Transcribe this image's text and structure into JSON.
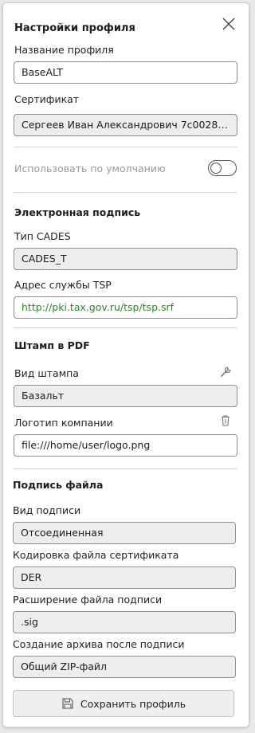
{
  "header": {
    "title": "Настройки профиля",
    "close_icon": "close-icon"
  },
  "profile": {
    "name_label": "Название профиля",
    "name_value": "BaseALT",
    "cert_label": "Сертификат",
    "cert_value": "Сергеев Иван Александрович 7c002876b7...",
    "default_label": "Использовать по умолчанию",
    "default_enabled": false
  },
  "signature": {
    "heading": "Электронная подпись",
    "type_label": "Тип CADES",
    "type_value": "CADES_T",
    "tsp_label": "Адрес службы TSP",
    "tsp_value": "http://pki.tax.gov.ru/tsp/tsp.srf"
  },
  "stamp": {
    "heading": "Штамп в PDF",
    "kind_label": "Вид штампа",
    "kind_value": "Базальт",
    "kind_icon": "wrench-icon",
    "logo_label": "Логотип компании",
    "logo_value": "file:///home/user/logo.png",
    "logo_icon": "trash-icon"
  },
  "file_sign": {
    "heading": "Подпись файла",
    "kind_label": "Вид подписи",
    "kind_value": "Отсоединенная",
    "encoding_label": "Кодировка файла сертификата",
    "encoding_value": "DER",
    "ext_label": "Расширение файла подписи",
    "ext_value": ".sig",
    "archive_label": "Создание архива после подписи",
    "archive_value": "Общий ZIP-файл"
  },
  "actions": {
    "save_label": "Сохранить профиль",
    "save_icon": "floppy-disk-icon"
  },
  "colors": {
    "link": "#2a8a2a",
    "field_gray": "#ededed",
    "border": "#8e8e8e"
  }
}
